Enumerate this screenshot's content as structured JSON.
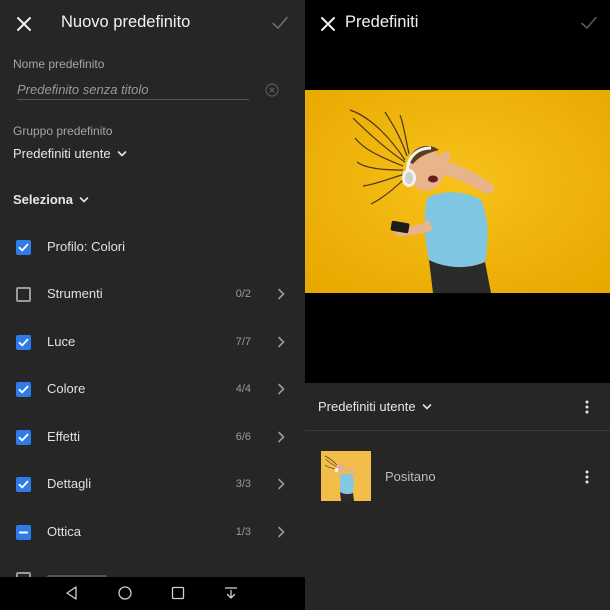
{
  "left": {
    "title": "Nuovo predefinito",
    "name_label": "Nome predefinito",
    "name_placeholder": "Predefinito senza titolo",
    "group_label": "Gruppo predefinito",
    "group_value": "Predefiniti utente",
    "select_label": "Seleziona",
    "items": [
      {
        "label": "Profilo: Colori",
        "count": "",
        "state": "checked",
        "has_arrow": false
      },
      {
        "label": "Strumenti",
        "count": "0/2",
        "state": "unchecked",
        "has_arrow": true
      },
      {
        "label": "Luce",
        "count": "7/7",
        "state": "checked",
        "has_arrow": true
      },
      {
        "label": "Colore",
        "count": "4/4",
        "state": "checked",
        "has_arrow": true
      },
      {
        "label": "Effetti",
        "count": "6/6",
        "state": "checked",
        "has_arrow": true
      },
      {
        "label": "Dettagli",
        "count": "3/3",
        "state": "checked",
        "has_arrow": true
      },
      {
        "label": "Ottica",
        "count": "1/3",
        "state": "partial",
        "has_arrow": true
      }
    ]
  },
  "right": {
    "title": "Predefiniti",
    "group_value": "Predefiniti utente",
    "preset_name": "Positano"
  },
  "colors": {
    "panel": "#262626",
    "accent": "#2f7be8",
    "photo_background": "#f2b705"
  },
  "icons": [
    "close-icon",
    "checkmark-icon",
    "clear-icon",
    "chevron-down-icon",
    "chevron-right-icon",
    "more-vertical-icon",
    "back-nav-icon",
    "home-nav-icon",
    "recents-nav-icon",
    "dropdown-nav-icon"
  ]
}
